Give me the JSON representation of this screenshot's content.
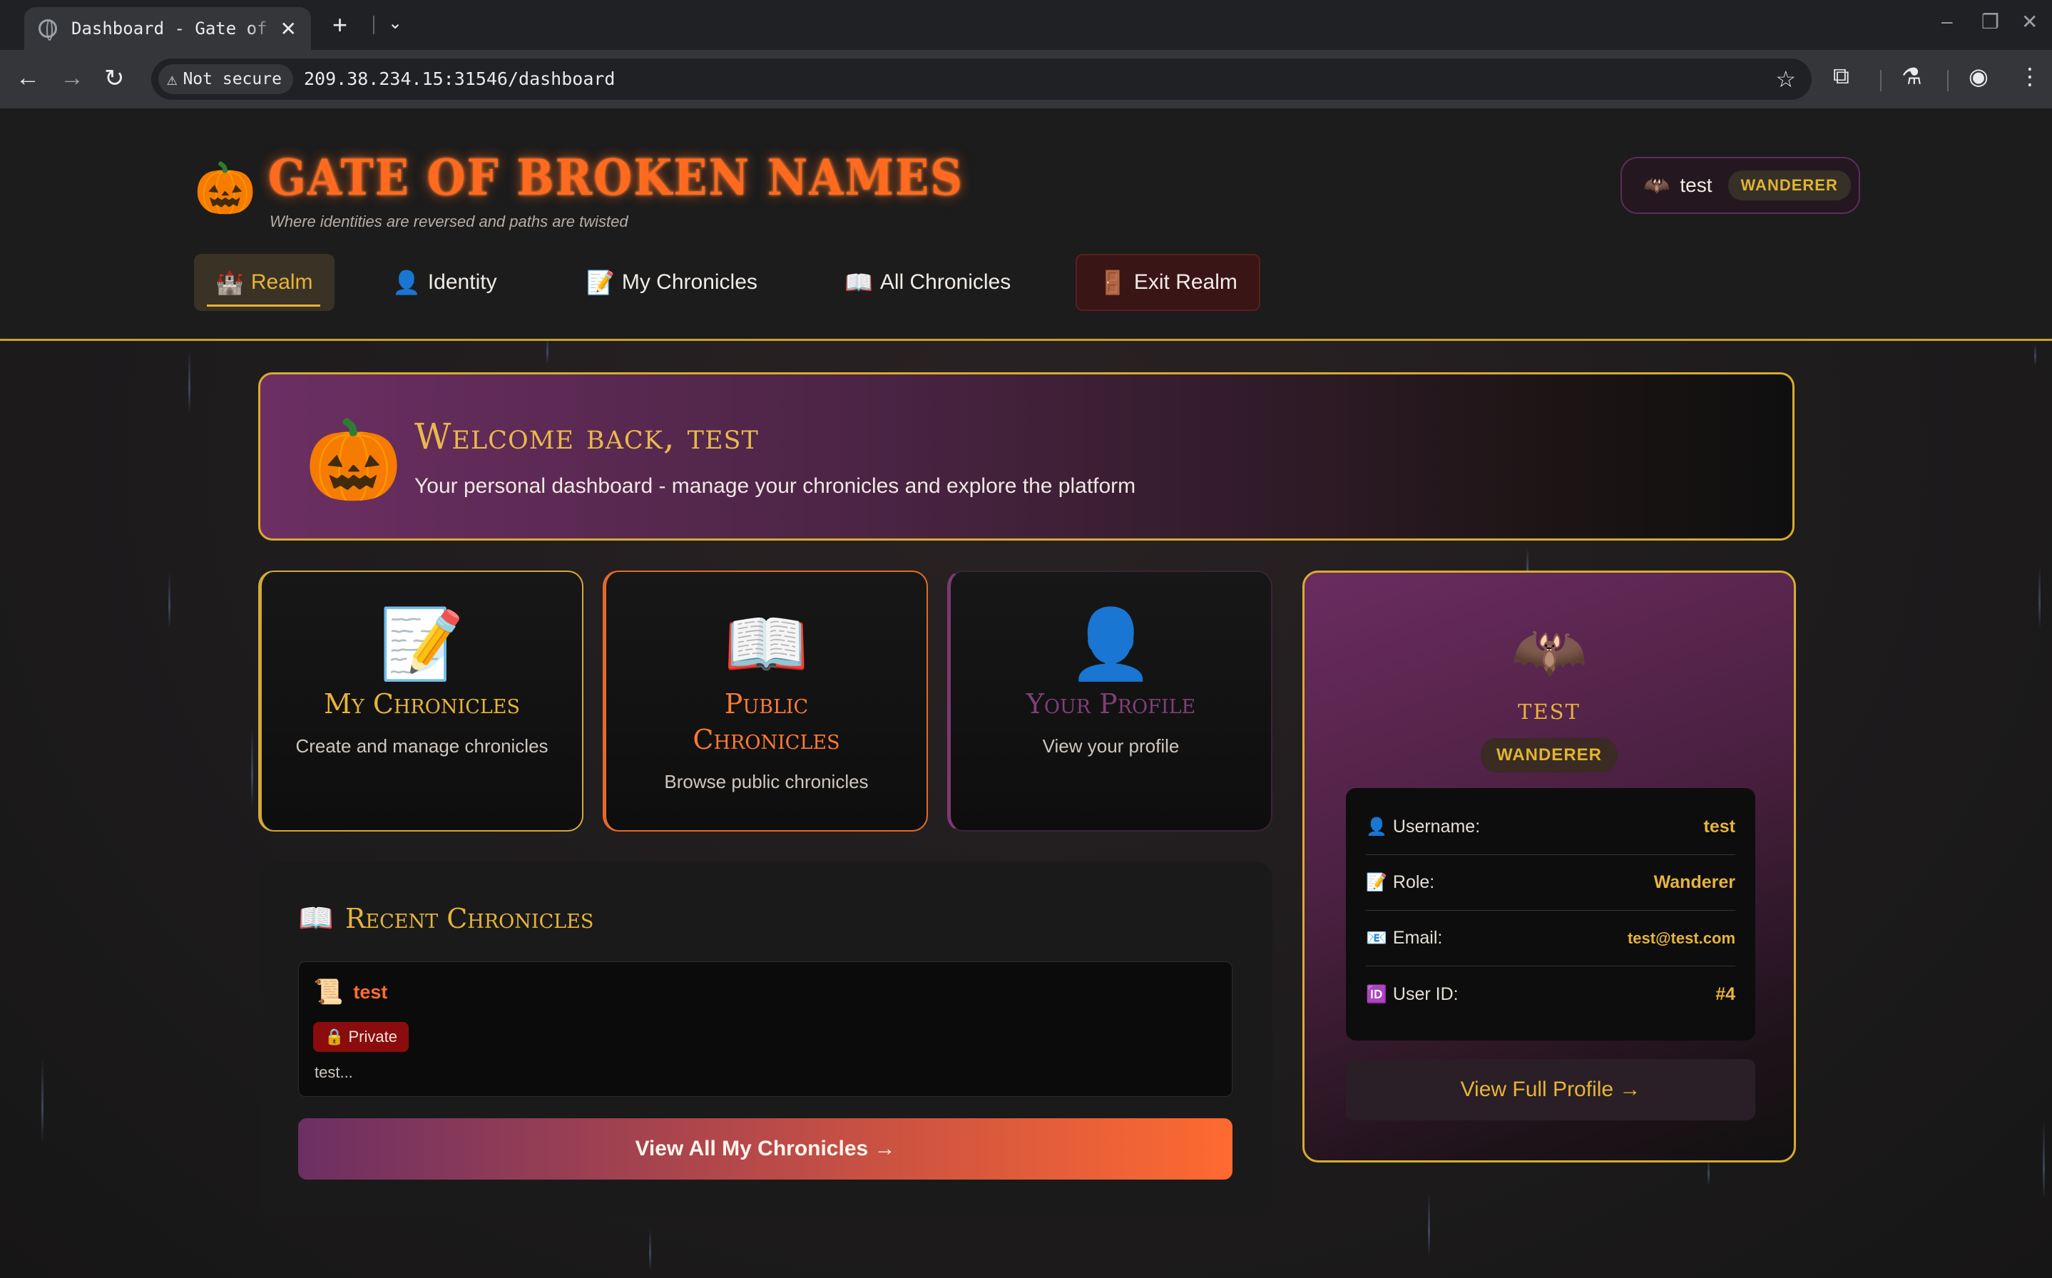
{
  "browser": {
    "tab_title": "Dashboard - Gate of Broken Names",
    "close_glyph": "✕",
    "new_tab_glyph": "+",
    "tab_menu_glyph": "⌄",
    "security_label": "Not secure",
    "url": "209.38.234.15:31546/dashboard",
    "icons": [
      "back-arrow-icon",
      "forward-arrow-icon",
      "reload-icon",
      "bookmark-star-icon",
      "extensions-icon",
      "labs-flask-icon",
      "profile-icon",
      "menu-kebab-icon"
    ]
  },
  "site": {
    "logo_emoji": "🎃",
    "title": "Gate of Broken Names",
    "tagline": "Where identities are reversed and paths are twisted",
    "user_chip": {
      "icon": "🦇",
      "username": "test",
      "role_badge": "WANDERER"
    },
    "nav": [
      {
        "icon": "🏰",
        "label": "Realm",
        "active": true
      },
      {
        "icon": "👤",
        "label": "Identity"
      },
      {
        "icon": "📝",
        "label": "My Chronicles"
      },
      {
        "icon": "📖",
        "label": "All Chronicles"
      },
      {
        "icon": "🚪",
        "label": "Exit Realm"
      }
    ]
  },
  "welcome": {
    "icon": "🎃",
    "heading": "Welcome back, test",
    "subtitle": "Your personal dashboard - manage your chronicles and explore the platform"
  },
  "cards": [
    {
      "icon": "📝",
      "title": "My Chronicles",
      "description": "Create and manage chronicles"
    },
    {
      "icon": "📖",
      "title": "Public Chronicles",
      "description": "Browse public chronicles"
    },
    {
      "icon": "👤",
      "title": "Your Profile",
      "description": "View your profile"
    }
  ],
  "profile": {
    "icon": "🦇",
    "name": "test",
    "role_badge": "WANDERER",
    "rows": [
      {
        "icon": "👤",
        "label": "Username:",
        "value": "test"
      },
      {
        "icon": "📝",
        "label": "Role:",
        "value": "Wanderer"
      },
      {
        "icon": "📧",
        "label": "Email:",
        "value": "test@test.com"
      },
      {
        "icon": "🆔",
        "label": "User ID:",
        "value": "#4"
      }
    ],
    "button": "View Full Profile →"
  },
  "recent": {
    "icon": "📖",
    "heading": "Recent Chronicles",
    "items": [
      {
        "icon": "📜",
        "title": "test",
        "visibility": "🔒 Private",
        "excerpt": "test..."
      }
    ],
    "button": "View All My Chronicles →"
  },
  "colors": {
    "accent_gold": "#e6b43a",
    "accent_orange": "#ff6a1f",
    "purple": "#6c2f63",
    "private_red": "#8a0c0c"
  }
}
